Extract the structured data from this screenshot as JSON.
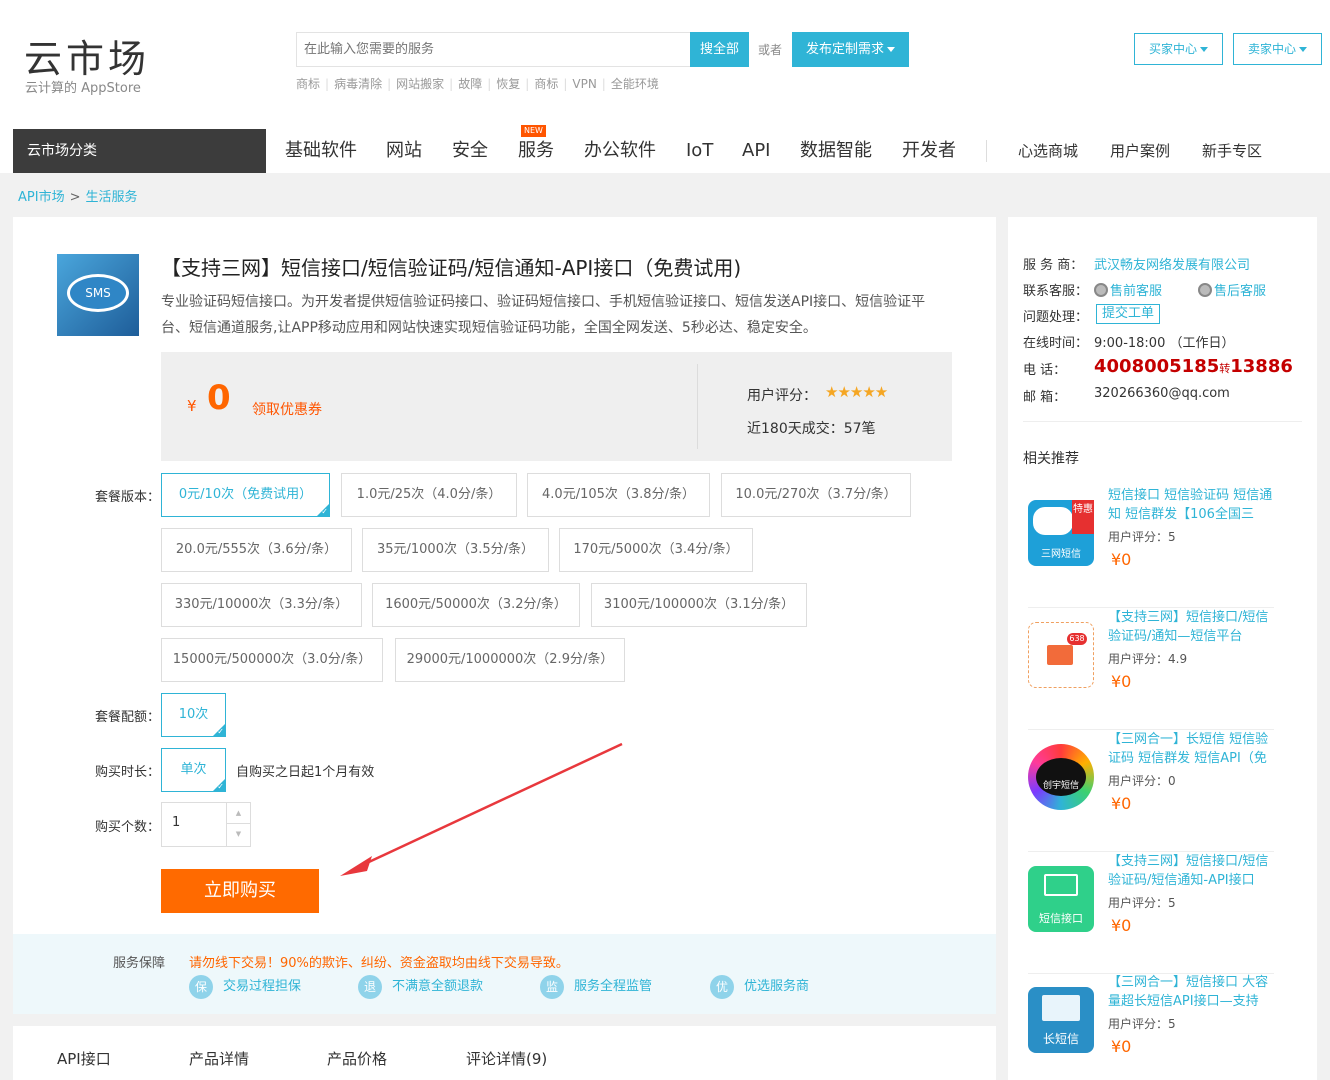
{
  "header": {
    "logo_main": "云市场",
    "logo_sub": "云计算的 AppStore",
    "search_placeholder": "在此输入您需要的服务",
    "search_button": "搜全部",
    "or_text": "或者",
    "custom_button": "发布定制需求",
    "hot_words": [
      "商标",
      "病毒清除",
      "网站搬家",
      "故障",
      "恢复",
      "商标",
      "VPN",
      "全能环境"
    ],
    "buyer_center": "买家中心",
    "seller_center": "卖家中心"
  },
  "nav": {
    "category": "云市场分类",
    "items": [
      "基础软件",
      "网站",
      "安全",
      "服务",
      "办公软件",
      "IoT",
      "API",
      "数据智能",
      "开发者"
    ],
    "new_badge": "NEW",
    "extra": [
      "心选商城",
      "用户案例",
      "新手专区"
    ]
  },
  "breadcrumb": [
    "API市场",
    "生活服务"
  ],
  "product": {
    "icon_text": "SMS",
    "title": "【支持三网】短信接口/短信验证码/短信通知-API接口（免费试用)",
    "description": "专业验证码短信接口。为开发者提供短信验证码接口、验证码短信接口、手机短信验证接口、短信发送API接口、短信验证平台、短信通道服务,让APP移动应用和网站快速实现短信验证码功能，全国全网发送、5秒必达、稳定安全。",
    "currency": "¥",
    "price": "0",
    "coupon": "领取优惠券",
    "rating_label": "用户评分：",
    "rating_stars": "★★★★★",
    "rating_value": 5,
    "deals": "近180天成交：57笔"
  },
  "options": {
    "package_label": "套餐版本：",
    "packages": [
      "0元/10次（免费试用）",
      "1.0元/25次（4.0分/条）",
      "4.0元/105次（3.8分/条）",
      "10.0元/270次（3.7分/条）",
      "20.0元/555次（3.6分/条）",
      "35元/1000次（3.5分/条）",
      "170元/5000次（3.4分/条）",
      "330元/10000次（3.3分/条）",
      "1600元/50000次（3.2分/条）",
      "3100元/100000次（3.1分/条）",
      "15000元/500000次（3.0分/条）",
      "29000元/1000000次（2.9分/条）"
    ],
    "quota_label": "套餐配额：",
    "quota_value": "10次",
    "duration_label": "购买时长：",
    "duration_value": "单次",
    "duration_note": "自购买之日起1个月有效",
    "qty_label": "购买个数：",
    "qty_value": "1",
    "buy_button": "立即购买"
  },
  "guarantee": {
    "label": "服务保障",
    "warning": "请勿线下交易！90%的欺诈、纠纷、资金盗取均由线下交易导致。",
    "items": [
      {
        "icon": "保",
        "text": "交易过程担保"
      },
      {
        "icon": "退",
        "text": "不满意全额退款"
      },
      {
        "icon": "监",
        "text": "服务全程监管"
      },
      {
        "icon": "优",
        "text": "优选服务商"
      }
    ]
  },
  "tabs": [
    "API接口",
    "产品详情",
    "产品价格",
    "评论详情(9)"
  ],
  "sidebar": {
    "provider_label": "服 务 商：",
    "provider": "武汉畅友网络发展有限公司",
    "contact_label": "联系客服：",
    "presale": "售前客服",
    "aftersale": "售后客服",
    "issue_label": "问题处理：",
    "ticket": "提交工单",
    "hours_label": "在线时间：",
    "hours": "9:00-18:00 （工作日）",
    "phone_label": "电 话：",
    "phone_main": "4008005185",
    "phone_ext_label": "转",
    "phone_ext": "13886",
    "email_label": "邮 箱：",
    "email": "320266360@qq.com",
    "rec_title": "相关推荐",
    "recommendations": [
      {
        "name": "短信接口 短信验证码 短信通知 短信群发【106全国三",
        "rating": "用户评分：5",
        "price": "¥0",
        "badge": "特惠",
        "img_text": "三网短信"
      },
      {
        "name": "【支持三网】短信接口/短信验证码/通知—短信平台",
        "rating": "用户评分：4.9",
        "price": "¥0",
        "badge": "",
        "img_text": "638"
      },
      {
        "name": "【三网合一】长短信 短信验证码 短信群发 短信API（免",
        "rating": "用户评分：0",
        "price": "¥0",
        "badge": "",
        "img_text": "创宇短信"
      },
      {
        "name": "【支持三网】短信接口/短信验证码/短信通知-API接口",
        "rating": "用户评分：5",
        "price": "¥0",
        "badge": "",
        "img_text": "短信接口"
      },
      {
        "name": "【三网合一】短信接口 大容量超长短信API接口—支持",
        "rating": "用户评分：5",
        "price": "¥0",
        "badge": "",
        "img_text": "长短信"
      }
    ]
  },
  "colors": {
    "accent": "#2fb4d6",
    "price": "#ff6600",
    "buy_button": "#ff6a00",
    "phone": "#c40000",
    "arrow": "#e8383d"
  }
}
